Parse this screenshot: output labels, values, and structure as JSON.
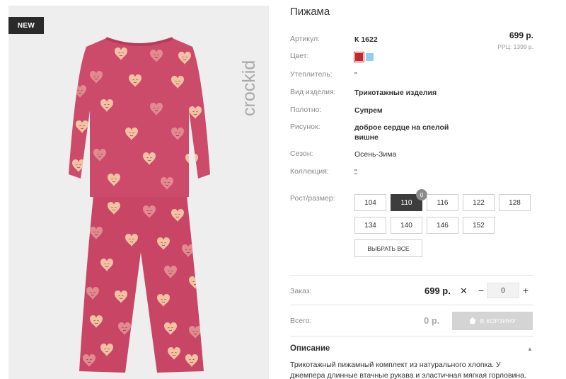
{
  "badge": {
    "label": "NEW"
  },
  "brand": {
    "name": "crockid"
  },
  "product": {
    "title": "Пижама",
    "price": "699 р.",
    "rrp": "РРЦ: 1399 р."
  },
  "specs": [
    {
      "label": "Артикул:",
      "value": "К 1622"
    },
    {
      "label": "Цвет:",
      "value": ""
    },
    {
      "label": "Утеплитель:",
      "value": "\""
    },
    {
      "label": "Вид изделия:",
      "value": "Трикотажные изделия"
    },
    {
      "label": "Полотно:",
      "value": "Супрем"
    },
    {
      "label": "Рисунок:",
      "value": "доброе сердце на спелой вишне"
    },
    {
      "label": "Сезон:",
      "value": "Осень-Зима"
    },
    {
      "label": "Коллекция:",
      "value": "\""
    }
  ],
  "colors": {
    "selected": "#c8262d",
    "other": "#8fd0f2"
  },
  "sizes": {
    "label": "Рост/размер:",
    "options": [
      "104",
      "110",
      "116",
      "122",
      "128",
      "134",
      "140",
      "146",
      "152"
    ],
    "selected": "110",
    "selected_count": "0",
    "select_all_label": "ВЫБРАТЬ ВСЕ"
  },
  "order": {
    "label": "Заказ:",
    "price": "699 р.",
    "times": "✕",
    "minus": "−",
    "quantity": "0",
    "plus": "+"
  },
  "total": {
    "label": "Всего:",
    "value": "0 р.",
    "cart_button": "В КОРЗИНУ"
  },
  "description": {
    "title": "Описание",
    "text": "Трикотажный пижамный комплект из натурального хлопка. У джемпера длинные втачные рукава и эластичная мягкая горловина."
  }
}
